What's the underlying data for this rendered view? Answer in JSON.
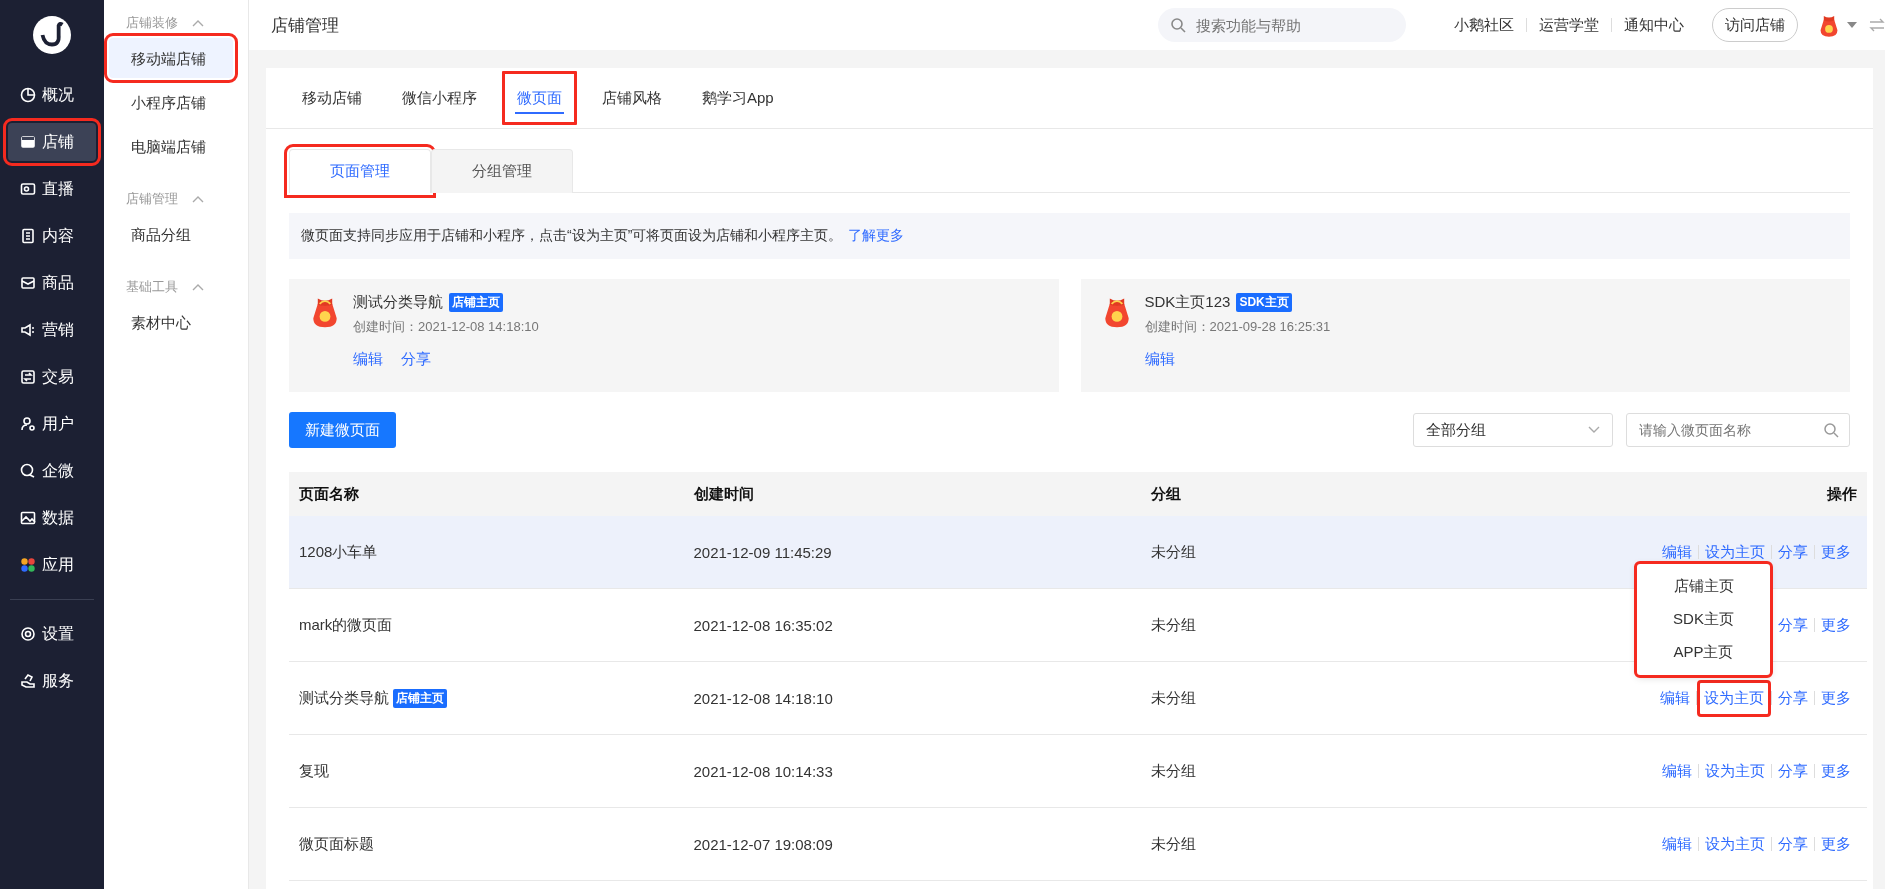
{
  "nav": {
    "items": [
      {
        "label": "概况",
        "selected": false,
        "highlighted": false
      },
      {
        "label": "店铺",
        "selected": true,
        "highlighted": true
      },
      {
        "label": "直播",
        "selected": false,
        "highlighted": false
      },
      {
        "label": "内容",
        "selected": false,
        "highlighted": false
      },
      {
        "label": "商品",
        "selected": false,
        "highlighted": false
      },
      {
        "label": "营销",
        "selected": false,
        "highlighted": false
      },
      {
        "label": "交易",
        "selected": false,
        "highlighted": false
      },
      {
        "label": "用户",
        "selected": false,
        "highlighted": false
      },
      {
        "label": "企微",
        "selected": false,
        "highlighted": false
      },
      {
        "label": "数据",
        "selected": false,
        "highlighted": false
      },
      {
        "label": "应用",
        "selected": false,
        "highlighted": false
      }
    ],
    "bottom_items": [
      {
        "label": "设置",
        "selected": false,
        "highlighted": false
      },
      {
        "label": "服务",
        "selected": false,
        "highlighted": false
      }
    ]
  },
  "subnav": {
    "groups": [
      {
        "title": "店铺装修",
        "expanded": true,
        "items": [
          {
            "label": "移动端店铺",
            "selected": true,
            "highlighted": true
          },
          {
            "label": "小程序店铺",
            "selected": false,
            "highlighted": false
          },
          {
            "label": "电脑端店铺",
            "selected": false,
            "highlighted": false
          }
        ]
      },
      {
        "title": "店铺管理",
        "expanded": true,
        "items": [
          {
            "label": "商品分组",
            "selected": false,
            "highlighted": false
          }
        ]
      },
      {
        "title": "基础工具",
        "expanded": true,
        "items": [
          {
            "label": "素材中心",
            "selected": false,
            "highlighted": false
          }
        ]
      }
    ]
  },
  "header": {
    "title": "店铺管理",
    "search": {
      "placeholder": "搜索功能与帮助"
    },
    "links": [
      "小鹅社区",
      "运营学堂",
      "通知中心"
    ],
    "visit_button": "访问店铺"
  },
  "tabs": [
    {
      "label": "移动店铺",
      "selected": false,
      "highlighted": false
    },
    {
      "label": "微信小程序",
      "selected": false,
      "highlighted": false
    },
    {
      "label": "微页面",
      "selected": true,
      "highlighted": true
    },
    {
      "label": "店铺风格",
      "selected": false,
      "highlighted": false
    },
    {
      "label": "鹅学习App",
      "selected": false,
      "highlighted": false
    }
  ],
  "subtabs": [
    {
      "label": "页面管理",
      "selected": true,
      "highlighted": true
    },
    {
      "label": "分组管理",
      "selected": false,
      "highlighted": false
    }
  ],
  "notice": {
    "text": "微页面支持同步应用于店铺和小程序，点击“设为主页”可将页面设为店铺和小程序主页。",
    "link": "了解更多"
  },
  "home_cards": [
    {
      "name": "测试分类导航",
      "badge": "店铺主页",
      "created": "创建时间：2021-12-08 14:18:10",
      "actions": [
        "编辑",
        "分享"
      ]
    },
    {
      "name": "SDK主页123",
      "badge": "SDK主页",
      "created": "创建时间：2021-09-28 16:25:31",
      "actions": [
        "编辑"
      ]
    }
  ],
  "toolbar": {
    "create_button": "新建微页面",
    "group_select": {
      "value": "全部分组"
    },
    "search": {
      "placeholder": "请输入微页面名称"
    }
  },
  "table": {
    "columns": [
      "页面名称",
      "创建时间",
      "分组",
      "操作"
    ],
    "rows": [
      {
        "name": "1208小车单",
        "created": "2021-12-09 11:45:29",
        "group": "未分组",
        "hovered": true,
        "actions": [
          {
            "label": "编辑",
            "highlighted": false
          },
          {
            "label": "设为主页",
            "highlighted": false
          },
          {
            "label": "分享",
            "highlighted": false
          },
          {
            "label": "更多",
            "highlighted": false
          }
        ]
      },
      {
        "name": "mark的微页面",
        "created": "2021-12-08 16:35:02",
        "group": "未分组",
        "hovered": false,
        "actions": [
          {
            "label": "分享",
            "highlighted": false
          },
          {
            "label": "更多",
            "highlighted": false
          }
        ]
      },
      {
        "name": "测试分类导航",
        "badge": "店铺主页",
        "created": "2021-12-08 14:18:10",
        "group": "未分组",
        "hovered": false,
        "actions": [
          {
            "label": "编辑",
            "highlighted": false
          },
          {
            "label": "设为主页",
            "highlighted": true
          },
          {
            "label": "分享",
            "highlighted": false
          },
          {
            "label": "更多",
            "highlighted": false
          }
        ]
      },
      {
        "name": "复现",
        "created": "2021-12-08 10:14:33",
        "group": "未分组",
        "hovered": false,
        "actions": [
          {
            "label": "编辑",
            "highlighted": false
          },
          {
            "label": "设为主页",
            "highlighted": false
          },
          {
            "label": "分享",
            "highlighted": false
          },
          {
            "label": "更多",
            "highlighted": false
          }
        ]
      },
      {
        "name": "微页面标题",
        "created": "2021-12-07 19:08:09",
        "group": "未分组",
        "hovered": false,
        "actions": [
          {
            "label": "编辑",
            "highlighted": false
          },
          {
            "label": "设为主页",
            "highlighted": false
          },
          {
            "label": "分享",
            "highlighted": false
          },
          {
            "label": "更多",
            "highlighted": false
          }
        ]
      }
    ]
  },
  "dropdown": {
    "highlighted": true,
    "items": [
      "店铺主页",
      "SDK主页",
      "APP主页"
    ]
  }
}
